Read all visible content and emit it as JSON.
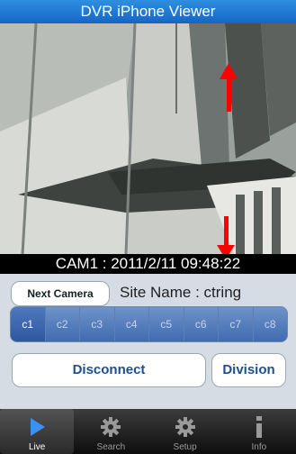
{
  "app": {
    "title": "DVR iPhone Viewer"
  },
  "video": {
    "caption": "CAM1 : 2011/2/11 09:48:22"
  },
  "controls": {
    "next_camera_label": "Next Camera",
    "site_name_text": "Site Name :  ctring",
    "channels": [
      {
        "label": "c1",
        "active": true
      },
      {
        "label": "c2",
        "active": false
      },
      {
        "label": "c3",
        "active": false
      },
      {
        "label": "c4",
        "active": false
      },
      {
        "label": "c5",
        "active": false
      },
      {
        "label": "c6",
        "active": false
      },
      {
        "label": "c7",
        "active": false
      },
      {
        "label": "c8",
        "active": false
      }
    ],
    "disconnect_label": "Disconnect",
    "division_label": "Division"
  },
  "tabbar": {
    "tabs": [
      {
        "label": "Live",
        "icon": "play-icon",
        "active": true
      },
      {
        "label": "Search",
        "icon": "gear-icon",
        "active": false
      },
      {
        "label": "Setup",
        "icon": "gear-icon",
        "active": false
      },
      {
        "label": "Info",
        "icon": "info-icon",
        "active": false
      }
    ]
  },
  "colors": {
    "title_bar": "#1f78d1",
    "channel_bar": "#4a74b8",
    "marker_arrow": "#ff0000"
  }
}
